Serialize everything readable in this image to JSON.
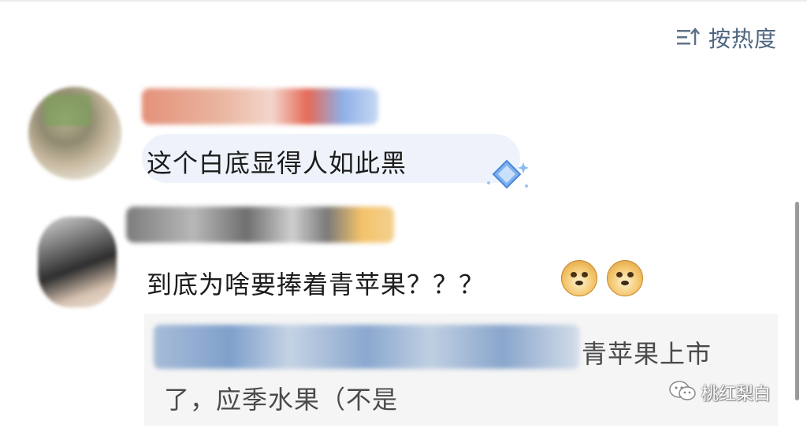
{
  "sort": {
    "label": "按热度",
    "icon": "sort-icon"
  },
  "comments": [
    {
      "text": "这个白底显得人如此黑",
      "badge_icon": "diamond-badge-icon"
    },
    {
      "text": "到底为啥要捧着青苹果？？？",
      "emoji": [
        "doge-emoji",
        "doge-emoji"
      ]
    }
  ],
  "reply": {
    "line1": "青苹果上市",
    "line2": "了，应季水果（不是"
  },
  "watermark": {
    "label": "桃红梨白",
    "icon": "wechat-icon"
  },
  "colors": {
    "accent": "#4d6580",
    "pill": "#eef3fb",
    "reply_bg": "#f5f5f5"
  }
}
